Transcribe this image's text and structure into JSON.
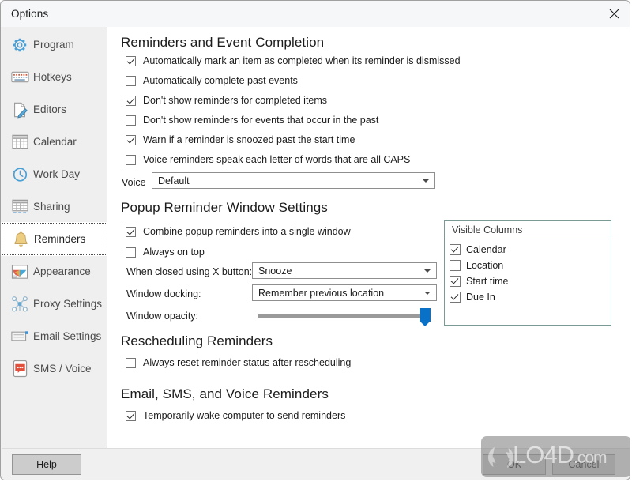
{
  "window": {
    "title": "Options",
    "close_icon": "close-icon"
  },
  "sidebar": {
    "items": [
      {
        "label": "Program",
        "icon": "gear-icon",
        "selected": false
      },
      {
        "label": "Hotkeys",
        "icon": "keyboard-icon",
        "selected": false
      },
      {
        "label": "Editors",
        "icon": "document-pencil-icon",
        "selected": false
      },
      {
        "label": "Calendar",
        "icon": "calendar-grid-icon",
        "selected": false
      },
      {
        "label": "Work Day",
        "icon": "clock-arrow-icon",
        "selected": false
      },
      {
        "label": "Sharing",
        "icon": "sharing-grid-icon",
        "selected": false
      },
      {
        "label": "Reminders",
        "icon": "bell-icon",
        "selected": true
      },
      {
        "label": "Appearance",
        "icon": "color-palette-icon",
        "selected": false
      },
      {
        "label": "Proxy Settings",
        "icon": "network-nodes-icon",
        "selected": false
      },
      {
        "label": "Email Settings",
        "icon": "envelope-icon",
        "selected": false
      },
      {
        "label": "SMS / Voice",
        "icon": "phone-chat-icon",
        "selected": false
      }
    ]
  },
  "content": {
    "section_reminders_completion": {
      "heading": "Reminders and Event Completion",
      "checkboxes": [
        {
          "label": "Automatically mark an item as completed when its reminder is dismissed",
          "checked": true
        },
        {
          "label": "Automatically complete past events",
          "checked": false
        },
        {
          "label": "Don't show reminders for completed items",
          "checked": true
        },
        {
          "label": "Don't show reminders for events that occur in the past",
          "checked": false
        },
        {
          "label": "Warn if a reminder is snoozed past the start time",
          "checked": true
        },
        {
          "label": "Voice reminders speak each letter of words that are all CAPS",
          "checked": false
        }
      ],
      "voice_label": "Voice",
      "voice_value": "Default"
    },
    "section_popup_window": {
      "heading": "Popup Reminder Window Settings",
      "checkboxes": [
        {
          "label": "Combine popup reminders into a single window",
          "checked": true
        },
        {
          "label": "Always on top",
          "checked": false
        }
      ],
      "close_button_label": "When closed using X button:",
      "close_button_value": "Snooze",
      "docking_label": "Window docking:",
      "docking_value": "Remember previous location",
      "opacity_label": "Window opacity:",
      "opacity_percent": 100
    },
    "section_rescheduling": {
      "heading": "Rescheduling Reminders",
      "checkboxes": [
        {
          "label": "Always reset reminder status after rescheduling",
          "checked": false
        }
      ]
    },
    "section_email_sms_voice": {
      "heading": "Email, SMS, and Voice Reminders",
      "checkboxes": [
        {
          "label": "Temporarily wake computer to send reminders",
          "checked": true
        }
      ]
    },
    "visible_columns": {
      "header": "Visible Columns",
      "rows": [
        {
          "label": "Calendar",
          "checked": true
        },
        {
          "label": "Location",
          "checked": false
        },
        {
          "label": "Start time",
          "checked": true
        },
        {
          "label": "Due In",
          "checked": true
        }
      ]
    }
  },
  "footer": {
    "help_label": "Help",
    "ok_label": "OK",
    "cancel_label": "Cancel"
  },
  "watermark": {
    "text": "LO4D",
    "suffix": ".com",
    "logo_icon": "refresh-arrows-icon"
  },
  "colors": {
    "accent": "#0a71c8",
    "sidebar_bg": "#efeff0",
    "content_bg": "#ffffff",
    "titlebar_bg": "#f6f7f9",
    "button_bg": "#cccccc"
  }
}
